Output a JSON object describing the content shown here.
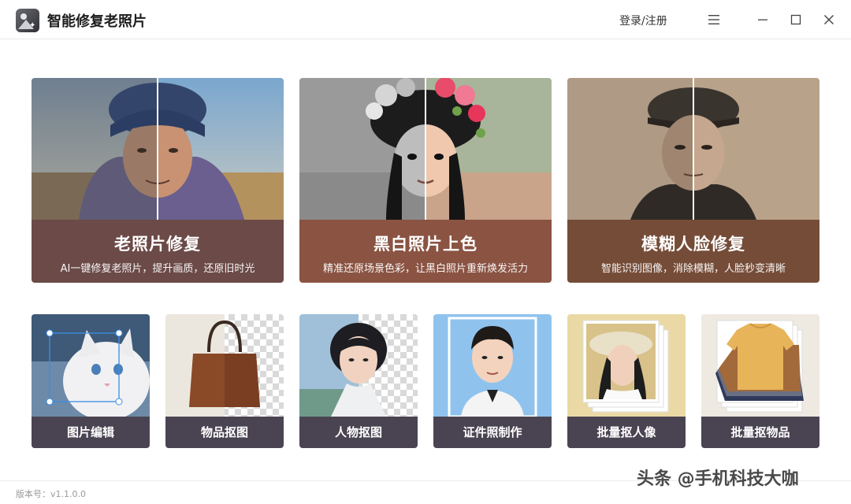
{
  "window": {
    "title": "智能修复老照片",
    "login_label": "登录/注册",
    "controls": [
      "menu-icon",
      "minimize-icon",
      "maximize-icon",
      "close-icon"
    ]
  },
  "features": [
    {
      "title": "老照片修复",
      "subtitle": "AI一键修复老照片，提升画质，还原旧时光",
      "color": "#6b4a47"
    },
    {
      "title": "黑白照片上色",
      "subtitle": "精准还原场景色彩，让黑白照片重新焕发活力",
      "color": "#8a5342"
    },
    {
      "title": "模糊人脸修复",
      "subtitle": "智能识别图像，消除模糊，人脸秒变清晰",
      "color": "#754c38"
    }
  ],
  "tools": [
    {
      "label": "图片编辑"
    },
    {
      "label": "物品抠图"
    },
    {
      "label": "人物抠图"
    },
    {
      "label": "证件照制作"
    },
    {
      "label": "批量抠人像"
    },
    {
      "label": "批量抠物品"
    }
  ],
  "footer": {
    "version": "版本号：v1.1.0.0",
    "watermark": "头条 @手机科技大咖"
  },
  "colors": {
    "tool_label_bg": "#4a4452",
    "accent_selection": "#3a8ee6"
  }
}
